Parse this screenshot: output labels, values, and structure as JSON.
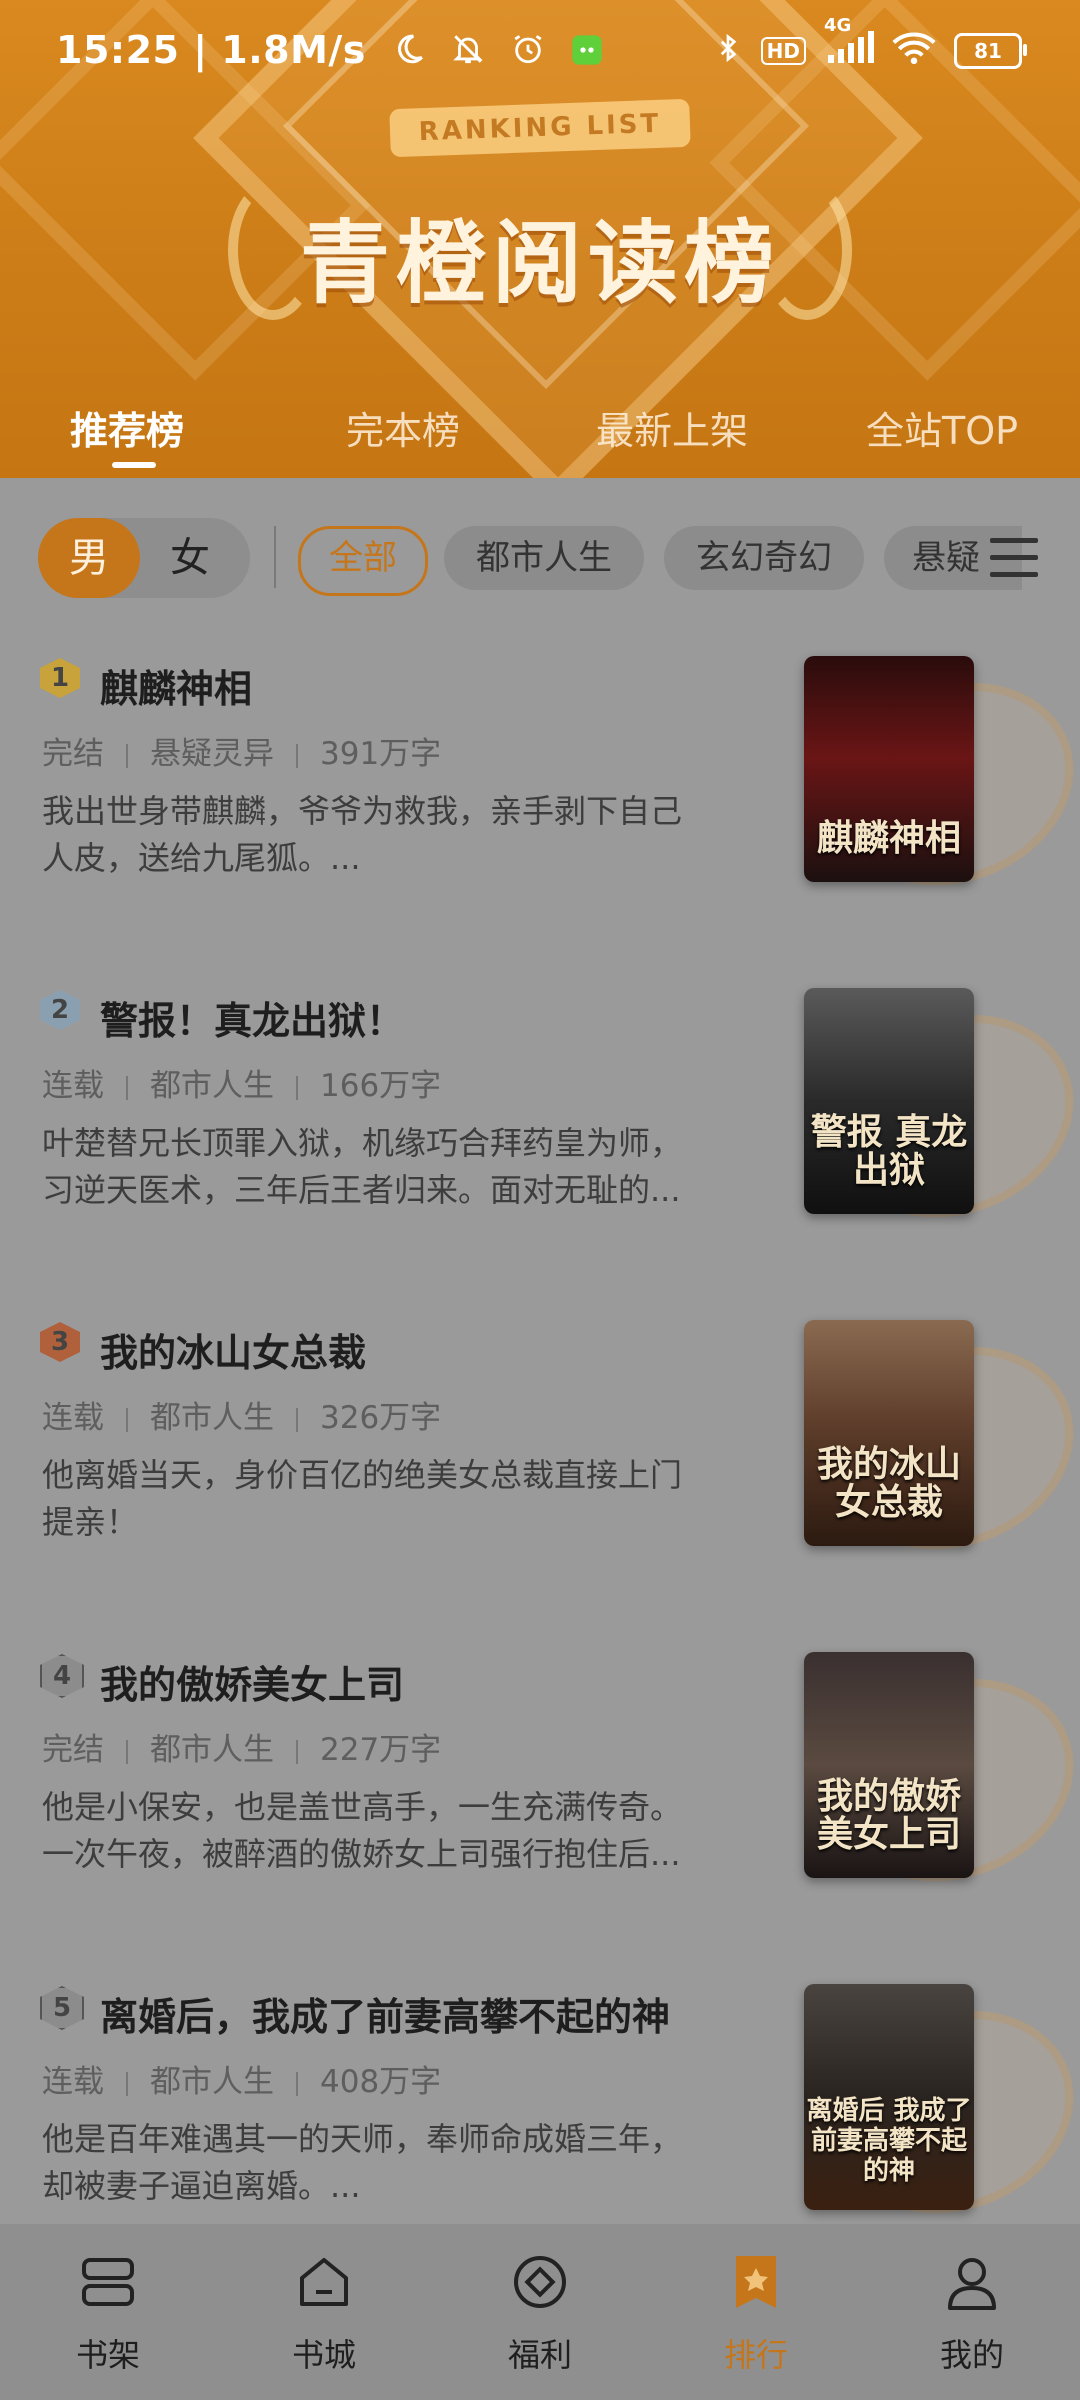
{
  "status_bar": {
    "time_speed": "15:25 | 1.8M/s",
    "network": "4G",
    "hd": "HD",
    "battery": "81"
  },
  "banner": {
    "ribbon": "RANKING LIST",
    "title": "青橙阅读榜"
  },
  "top_tabs": [
    "推荐榜",
    "完本榜",
    "最新上架",
    "全站TOP"
  ],
  "gender": {
    "male": "男",
    "female": "女"
  },
  "categories": [
    "全部",
    "都市人生",
    "玄幻奇幻",
    "悬疑"
  ],
  "books": [
    {
      "rank": "1",
      "title": "麒麟神相",
      "status": "完结",
      "genre": "悬疑灵异",
      "words": "391万字",
      "desc": "我出世身带麒麟，爷爷为救我，亲手剥下自己人皮，送给九尾狐。...",
      "cover_text": "麒麟神相"
    },
    {
      "rank": "2",
      "title": "警报！真龙出狱！",
      "status": "连载",
      "genre": "都市人生",
      "words": "166万字",
      "desc": "叶楚替兄长顶罪入狱，机缘巧合拜药皇为师，习逆天医术，三年后王者归来。面对无耻的...",
      "cover_text": "警报 真龙出狱"
    },
    {
      "rank": "3",
      "title": "我的冰山女总裁",
      "status": "连载",
      "genre": "都市人生",
      "words": "326万字",
      "desc": "他离婚当天，身价百亿的绝美女总裁直接上门提亲！",
      "cover_text": "我的冰山女总裁"
    },
    {
      "rank": "4",
      "title": "我的傲娇美女上司",
      "status": "完结",
      "genre": "都市人生",
      "words": "227万字",
      "desc": "他是小保安，也是盖世高手，一生充满传奇。一次午夜，被醉酒的傲娇女上司强行抱住后...",
      "cover_text": "我的傲娇美女上司"
    },
    {
      "rank": "5",
      "title": "离婚后，我成了前妻高攀不起的神",
      "status": "连载",
      "genre": "都市人生",
      "words": "408万字",
      "desc": "他是百年难遇其一的天师，奉师命成婚三年，却被妻子逼迫离婚。...",
      "cover_text": "离婚后 我成了前妻高攀不起的神"
    }
  ],
  "bottom_nav": [
    "书架",
    "书城",
    "福利",
    "排行",
    "我的"
  ],
  "colors": {
    "accent": "#c6761a",
    "header": "#d9891f"
  }
}
